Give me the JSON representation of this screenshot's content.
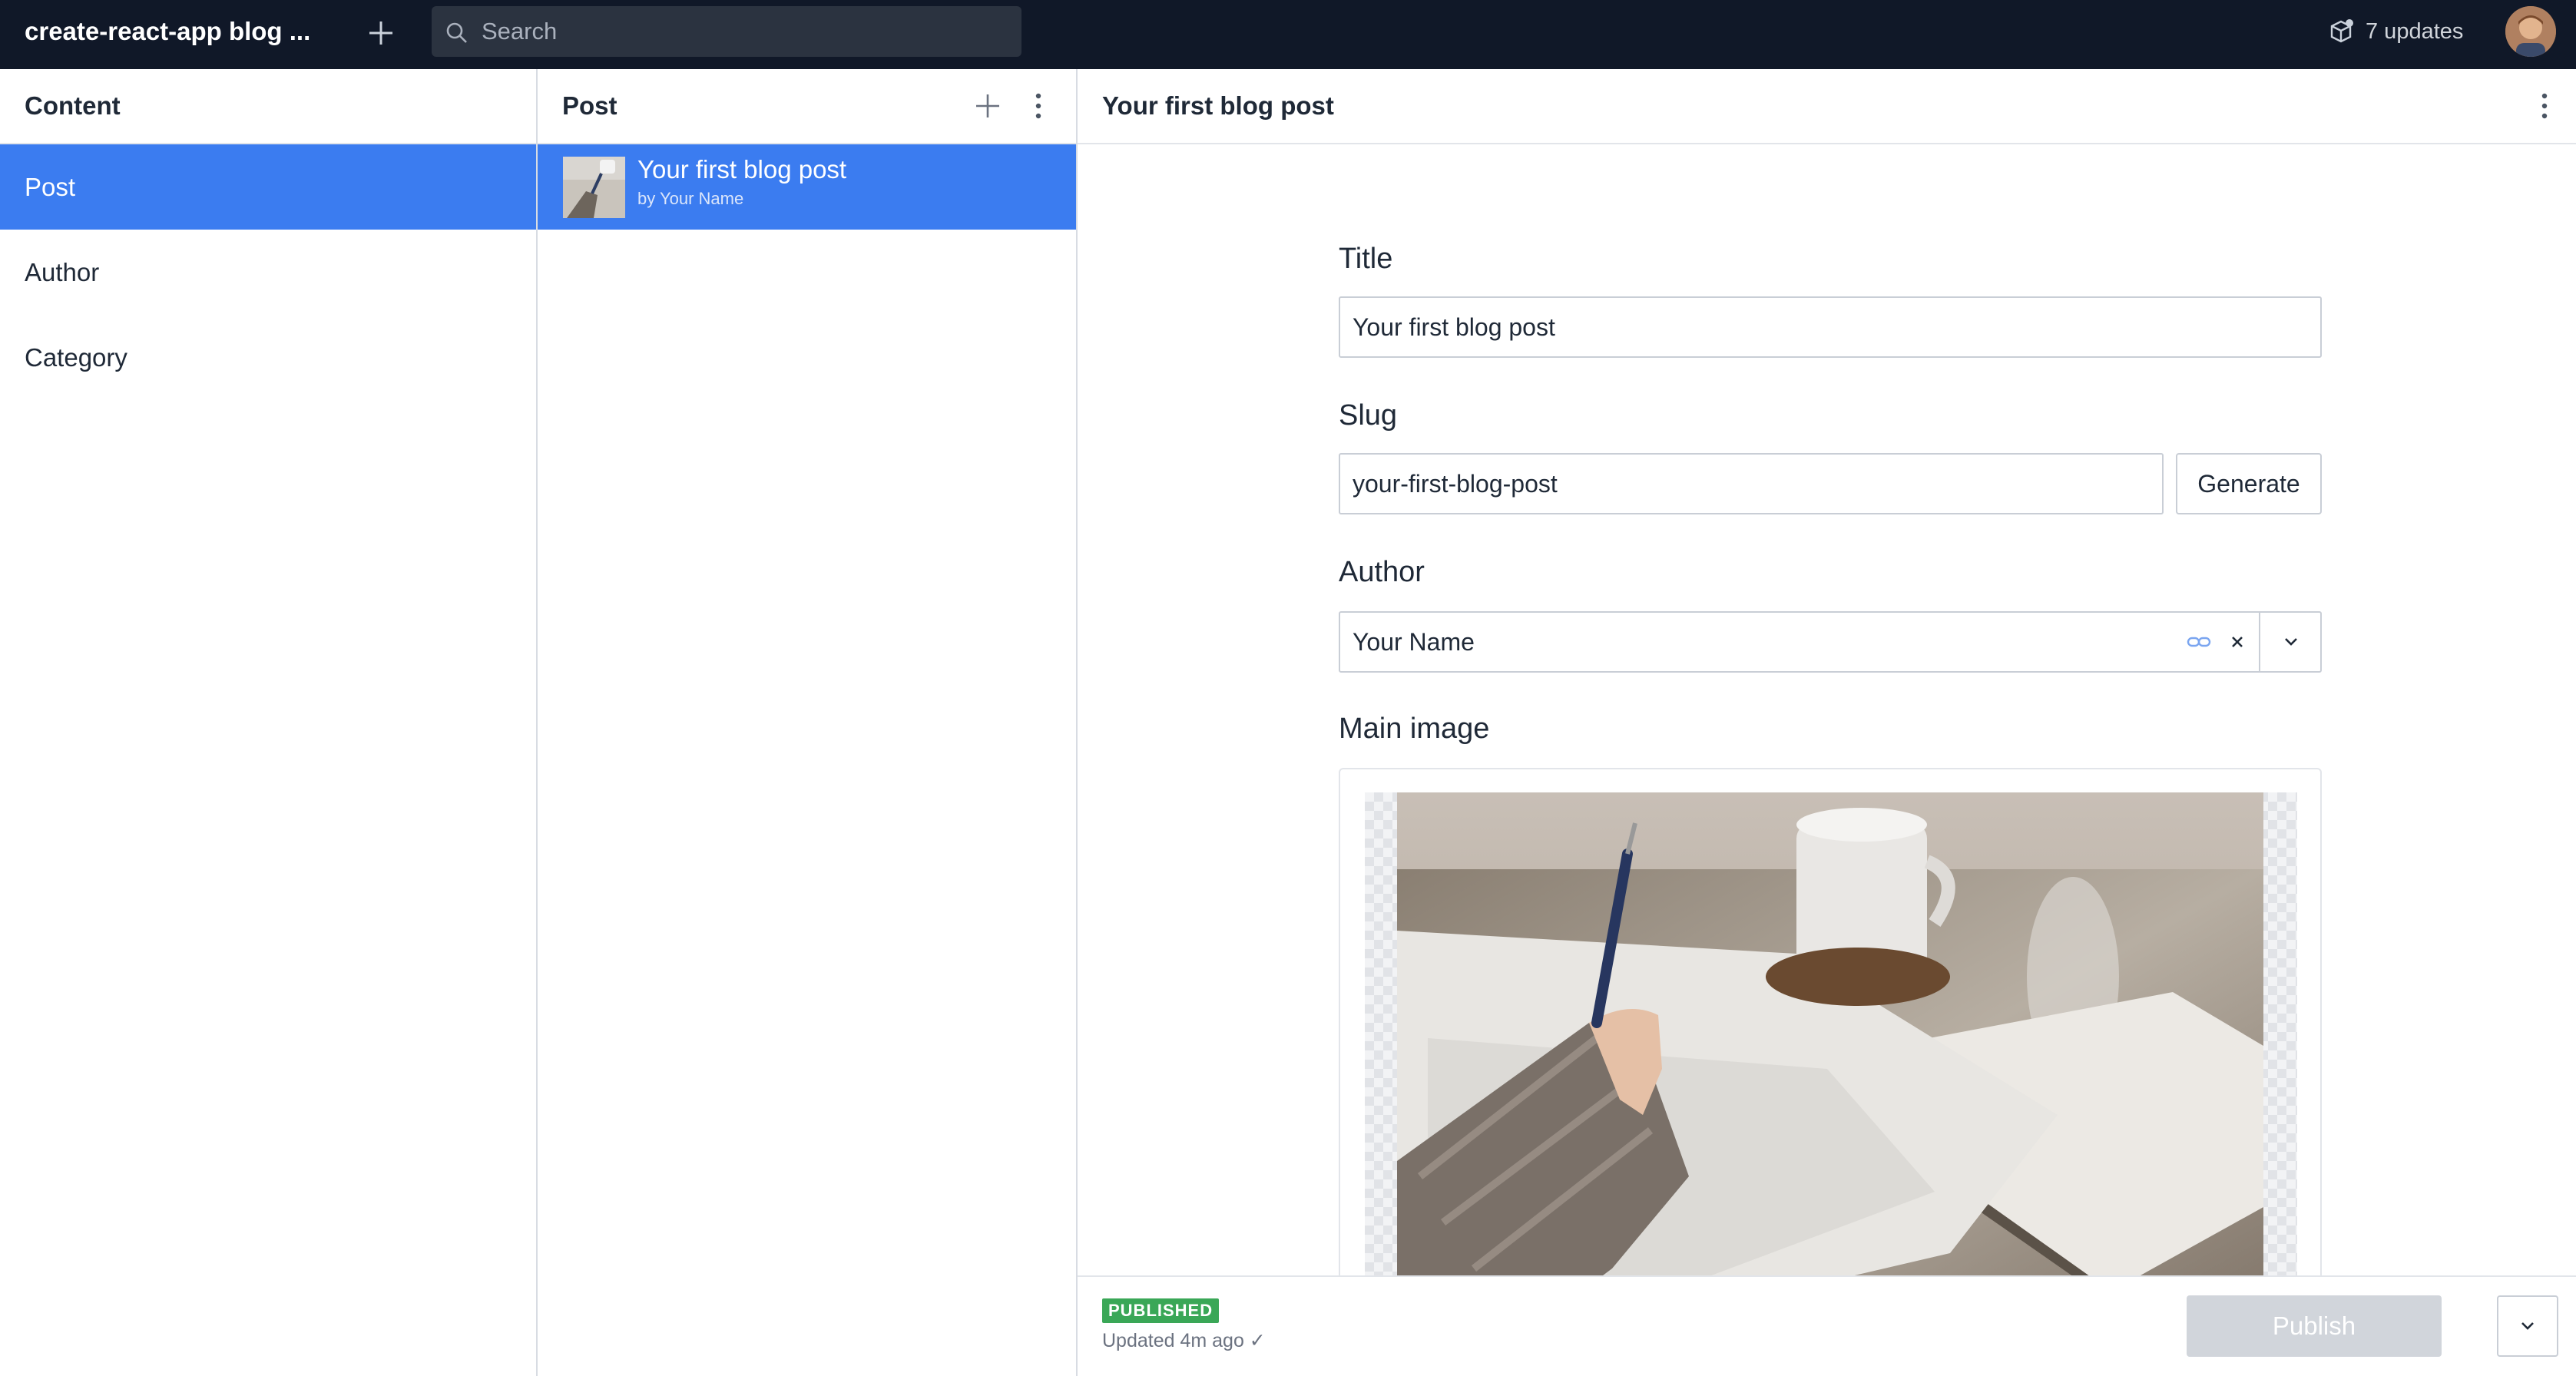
{
  "topbar": {
    "app_title": "create-react-app blog ...",
    "search_placeholder": "Search",
    "updates_label": "7 updates"
  },
  "content_pane": {
    "title": "Content",
    "items": [
      {
        "label": "Post",
        "active": true
      },
      {
        "label": "Author",
        "active": false
      },
      {
        "label": "Category",
        "active": false
      }
    ]
  },
  "post_pane": {
    "title": "Post",
    "documents": [
      {
        "title": "Your first blog post",
        "subtitle": "by Your Name"
      }
    ]
  },
  "document": {
    "title": "Your first blog post",
    "fields": {
      "title": {
        "label": "Title",
        "value": "Your first blog post"
      },
      "slug": {
        "label": "Slug",
        "value": "your-first-blog-post",
        "button": "Generate"
      },
      "author": {
        "label": "Author",
        "value": "Your Name"
      },
      "main_image": {
        "label": "Main image"
      }
    }
  },
  "footer": {
    "status_badge": "PUBLISHED",
    "updated": "Updated 4m ago ✓",
    "publish_label": "Publish"
  },
  "colors": {
    "topbar_bg": "#101828",
    "accent": "#3b7cf0",
    "published": "#3aa757"
  }
}
